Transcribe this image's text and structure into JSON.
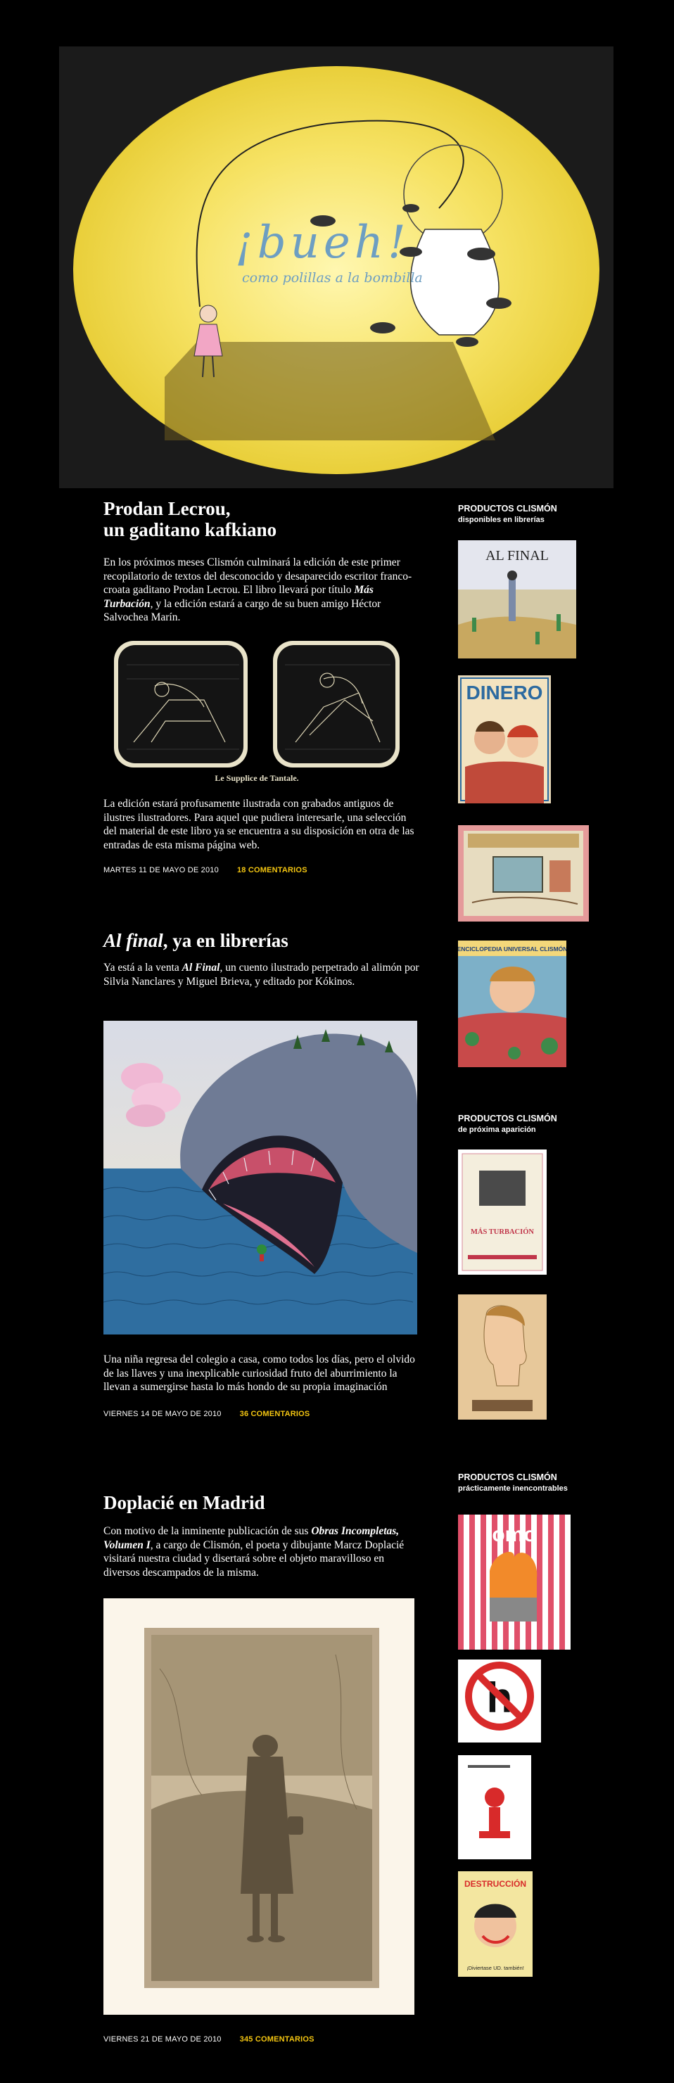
{
  "header": {
    "title": "¡bueh!",
    "subtitle": "como polillas a la bombilla"
  },
  "posts": [
    {
      "title_line1": "Prodan Lecrou,",
      "title_line2": "un gaditano kafkiano",
      "p1_a": "En los próximos meses Clismón culminará la edición de este primer recopilatorio de textos del desconocido y desaparecido escritor franco-croata gaditano Prodan Lecrou. El libro llevará por título ",
      "p1_em": "Más Turbación",
      "p1_b": ", y la edición estará a cargo de su buen amigo Héctor Salvochea Marín.",
      "caption": "Le Supplice de Tantale.",
      "p2": "La edición estará profusamente ilustrada con grabados antiguos de ilustres ilustradores. Para aquel que pudiera interesarle, una selección del material de este libro ya se encuentra a su disposición en otra de las entradas de esta misma página web.",
      "date": "MARTES 11 DE MAYO DE 2010",
      "comments": "18 COMENTARIOS"
    },
    {
      "title_em": "Al final",
      "title_rest": ", ya en librerías",
      "p1_a": "Ya está a la venta ",
      "p1_em": "Al Final",
      "p1_b": ", un cuento ilustrado perpetrado al alimón por Silvia Nanclares y Miguel Brieva, y editado por Kókinos.",
      "p2": "Una niña regresa del colegio a casa, como todos los días, pero el olvido de las llaves y una inexplicable curiosidad fruto del aburrimiento la llevan a sumergirse hasta lo más hondo de su propia imaginación",
      "date": "VIERNES 14 DE MAYO DE 2010",
      "comments": "36 COMENTARIOS"
    },
    {
      "title": "Doplacié en Madrid",
      "p1_a": "Con motivo de la inminente publicación de sus ",
      "p1_em": "Obras Incompletas, Volumen I",
      "p1_b": ", a cargo de Clismón, el poeta y dibujante Marcz Doplacié visitará nuestra ciudad y disertará sobre el objeto maravilloso en diversos descampados de la misma.",
      "date": "VIERNES 21 DE MAYO DE 2010",
      "comments": "345 COMENTARIOS"
    }
  ],
  "sidebar": {
    "section1_line1": "PRODUCTOS CLISMÓN",
    "section1_line2": "disponibles en librerías",
    "section2_line1": "PRODUCTOS CLISMÓN",
    "section2_line2": "de próxima aparición",
    "section3_line1": "PRODUCTOS CLISMÓN",
    "section3_line2": "prácticamente inencontrables",
    "book_alfinal": "AL FINAL",
    "book_dinero": "DINERO",
    "book_enciclopedia": "ENCICLOPEDIA UNIVERSAL CLISMÓN",
    "book_masturbacion": "MÁS TURBACIÓN",
    "book_omo": "omo",
    "book_destruccion": "DESTRUCCIÓN",
    "book_destruccion_sub": "¡Diviertase UD. también!"
  }
}
